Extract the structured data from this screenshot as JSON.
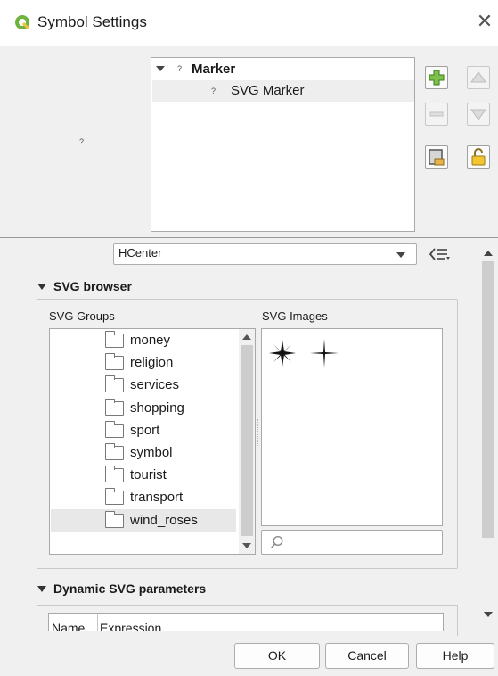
{
  "window": {
    "title": "Symbol Settings",
    "close_label": "✕"
  },
  "tree": {
    "root_label": "Marker",
    "child_label": "SVG Marker",
    "unknown_glyph": "?"
  },
  "left_panel": {
    "unknown_glyph": "?"
  },
  "toolbar": {
    "add": "add-layer-icon",
    "remove": "remove-layer-icon",
    "up": "move-up-icon",
    "down": "move-down-icon",
    "duplicate": "duplicate-layer-icon",
    "lock": "lock-icon"
  },
  "anchor": {
    "value": "HCenter"
  },
  "svg_browser": {
    "title": "SVG browser",
    "groups_label": "SVG Groups",
    "images_label": "SVG Images",
    "groups": [
      "money",
      "religion",
      "services",
      "shopping",
      "sport",
      "symbol",
      "tourist",
      "transport",
      "wind_roses"
    ],
    "selected_group": "wind_roses",
    "search_placeholder": ""
  },
  "dynamic": {
    "title": "Dynamic SVG parameters",
    "columns": [
      "Name",
      "Expression"
    ]
  },
  "buttons": {
    "ok": "OK",
    "cancel": "Cancel",
    "help": "Help"
  },
  "colors": {
    "accent_green": "#6fb33e",
    "selection": "#e8e8e8"
  }
}
